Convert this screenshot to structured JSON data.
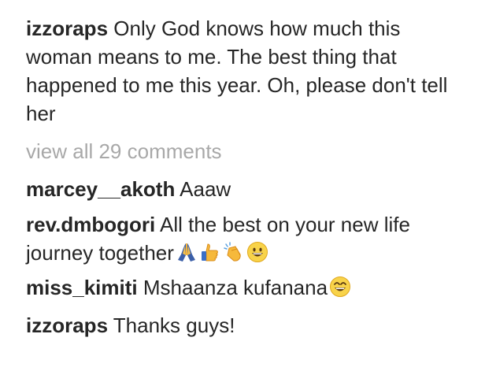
{
  "caption": {
    "username": "izzoraps",
    "text": "Only God knows how much this woman means to me. The best thing that happened to me this year. Oh, please don't tell her"
  },
  "view_all_label": "view all 29 comments",
  "comments": [
    {
      "username": "marcey__akoth",
      "text": "Aaaw"
    },
    {
      "username": "rev.dmbogori",
      "text": "All the best on your new life journey together",
      "emojis": [
        "folded-hands",
        "thumbs-up",
        "clapping-hands",
        "grinning-face"
      ]
    },
    {
      "username": "miss_kimiti",
      "text": "Mshaanza kufanana",
      "emojis": [
        "grinning-face-smiling-eyes"
      ]
    },
    {
      "username": "izzoraps",
      "text": "Thanks guys!"
    }
  ]
}
